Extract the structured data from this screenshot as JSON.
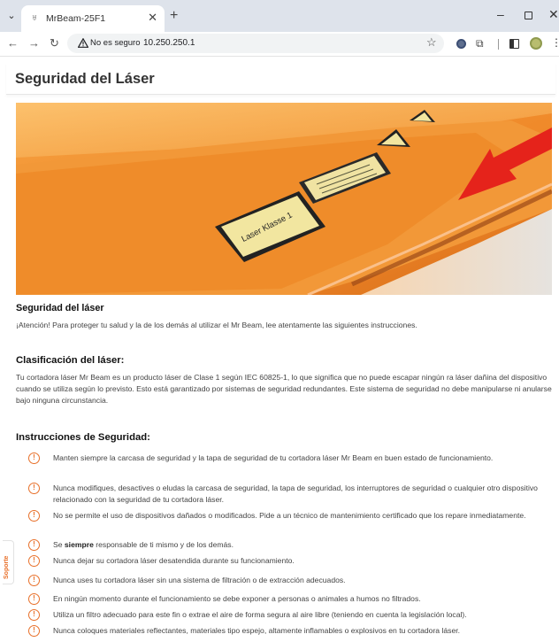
{
  "browser": {
    "tab_title": "MrBeam-25F1",
    "security_warning": "No es seguro",
    "url": "10.250.250.1"
  },
  "page": {
    "title": "Seguridad del Láser",
    "sign_text": "Laser Klasse 1",
    "side_tab_label": "Soporte"
  },
  "sections": {
    "safety": {
      "heading": "Seguridad del láser",
      "text": "¡Atención! Para proteger tu salud y la de los demás al utilizar el Mr Beam, lee atentamente las siguientes instrucciones."
    },
    "classification": {
      "heading": "Clasificación del láser:",
      "text": "Tu cortadora láser Mr Beam es un producto láser de Clase 1 según IEC 60825-1, lo que significa que no puede escapar ningún ra láser dañina del dispositivo cuando se utiliza según lo previsto. Esto está garantizado por sistemas de seguridad redundantes. Este sistema de seguridad no debe manipularse ni anularse bajo ninguna circunstancia."
    },
    "instructions": {
      "heading": "Instrucciones de Seguridad:",
      "items": [
        "Manten siempre la carcasa de seguridad y la tapa de seguridad de tu cortadora láser Mr Beam en buen estado de funcionamiento.",
        "Nunca modifiques, desactives o eludas la carcasa de seguridad, la tapa de seguridad, los interruptores de seguridad o cualquier otro dispositivo relacionado con la seguridad de tu cortadora láser.",
        "No se permite el uso de dispositivos dañados o modificados. Pide a un técnico de mantenimiento certificado que los repare inmediatamente.",
        "Se siempre responsable de ti mismo y de los demás.",
        "Nunca dejar su cortadora láser desatendida durante su funcionamiento.",
        "Nunca uses tu cortadora láser sin una sistema de filtración o de extracción adecuados.",
        "En ningún momento durante el funcionamiento se debe exponer a personas o animales a humos no filtrados.",
        "Utiliza un filtro adecuado para este fin o extrae el aire de forma segura al aire libre (teniendo en cuenta la legislación local).",
        "Nunca coloques materiales reflectantes, materiales tipo espejo, altamente inflamables o explosivos en tu cortadora láser."
      ],
      "item4_prefix": "Se ",
      "item4_bold": "siempre",
      "item4_suffix": " responsable de ti mismo y de los demás."
    }
  },
  "colors": {
    "accent": "#e8702a",
    "arrow": "#e5231b",
    "lid_orange": "#f08a2a"
  },
  "icons": [
    "chevron-down-icon",
    "favicon-icon",
    "close-icon",
    "plus-icon",
    "back-arrow-icon",
    "forward-arrow-icon",
    "reload-icon",
    "warning-triangle-icon",
    "star-icon",
    "extension-icon",
    "puzzle-icon",
    "side-panel-icon",
    "profile-avatar",
    "more-vert-icon",
    "info-circle-icon"
  ]
}
